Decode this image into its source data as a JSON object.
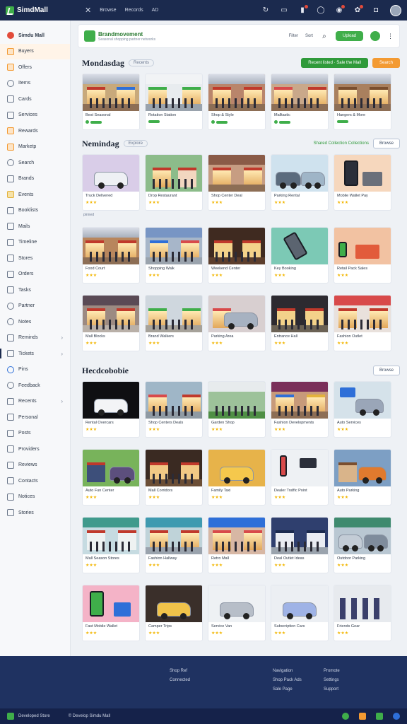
{
  "app": {
    "title": "SimdMall"
  },
  "topbar": {
    "nav": [
      "Browse",
      "Records",
      "AD"
    ]
  },
  "sidebar": {
    "header": "Simdu Mall",
    "items": [
      {
        "label": "Buyers",
        "icon": "tag-icon"
      },
      {
        "label": "Offers",
        "icon": "offer-icon"
      },
      {
        "label": "Items",
        "icon": "clock-icon"
      },
      {
        "label": "Cards",
        "icon": "card-icon"
      },
      {
        "label": "Services",
        "icon": "services-icon"
      },
      {
        "label": "Rewards",
        "icon": "rewards-icon"
      },
      {
        "label": "Marketp",
        "icon": "market-icon"
      },
      {
        "label": "Search",
        "icon": "search-icon"
      },
      {
        "label": "Brands",
        "icon": "brand-icon"
      },
      {
        "label": "Events",
        "icon": "event-icon"
      },
      {
        "label": "Booklists",
        "icon": "book-icon"
      },
      {
        "label": "Mails",
        "icon": "mail-icon"
      },
      {
        "label": "Timeline",
        "icon": "timeline-icon"
      },
      {
        "label": "Stores",
        "icon": "store-icon"
      },
      {
        "label": "Orders",
        "icon": "order-icon"
      },
      {
        "label": "Tasks",
        "icon": "task-icon"
      },
      {
        "label": "Partner",
        "icon": "partner-icon"
      },
      {
        "label": "Notes",
        "icon": "note-icon"
      },
      {
        "label": "Reminds",
        "icon": "remind-icon"
      },
      {
        "label": "Tickets",
        "icon": "ticket-icon"
      },
      {
        "label": "Pins",
        "icon": "pin-icon"
      },
      {
        "label": "Feedback",
        "icon": "feedback-icon"
      },
      {
        "label": "Recents",
        "icon": "recent-icon"
      },
      {
        "label": "Personal",
        "icon": "personal-icon"
      },
      {
        "label": "Posts",
        "icon": "post-icon"
      },
      {
        "label": "Providers",
        "icon": "provider-icon"
      },
      {
        "label": "Reviews",
        "icon": "review-icon"
      },
      {
        "label": "Contacts",
        "icon": "contact-icon"
      },
      {
        "label": "Notices",
        "icon": "notice-icon"
      },
      {
        "label": "Stories",
        "icon": "story-icon"
      }
    ]
  },
  "header_card": {
    "title": "Brandmovement",
    "subtitle": "Seasonal shopping partner networks",
    "actions": [
      "Filter",
      "Sort"
    ],
    "cta": "Upload"
  },
  "sections": [
    {
      "title": "Mondasdag",
      "badge": "Recents",
      "actions": [
        "Recent listed · Sale the Mall",
        "Search"
      ],
      "tiles": [
        "Best Seasonal",
        "Rotation Station",
        "Shop & Style",
        "Malltastic",
        "Hangers & More"
      ]
    },
    {
      "title": "Nemindag",
      "badge": "Explore",
      "link": "Shared Collection Collections",
      "actions": [
        "Browse"
      ],
      "note": "pinned",
      "tiles": [
        "Truck Delivered",
        "Drop Restaurant",
        "Shop Center Deal",
        "Parking Rental",
        "Mobile Wallet Pay",
        "Food Court",
        "Shopping Walk",
        "Weekend Center",
        "Key Booking",
        "Retail Pack Sales",
        "Mall Blocks",
        "Brand Walkers",
        "Parking Area",
        "Entrance Hall",
        "Fashion Outlet"
      ]
    },
    {
      "title": "Hecdcobobie",
      "actions": [
        "Browse"
      ],
      "tiles": [
        "Rental Overcars",
        "Shop Centers Deals",
        "Garden Shop",
        "Fashion Developments",
        "Auto Services",
        "Auto Fun Center",
        "Mall Corridors",
        "Family Taxi",
        "Dealer Traffic Point",
        "Auto Parking",
        "Mall Season Stores",
        "Fashion Hallway",
        "Retro Mall",
        "Deal Outlet Ideas",
        "Outdoor Parking",
        "Fast Mobile Wallet",
        "Camper Trips",
        "Service Van",
        "Subscription Cars",
        "Friends Gear"
      ]
    }
  ],
  "footer": {
    "col1": [
      "Shop Ref",
      "Connected"
    ],
    "col2": [
      "Navigation",
      "Shop Pack Ads",
      "Sale Page"
    ],
    "col3": [
      "Promote",
      "Settings",
      "Support"
    ]
  },
  "bottombar": {
    "brand": "Developed Store",
    "copyright": "© Develop Simdu Mall"
  }
}
